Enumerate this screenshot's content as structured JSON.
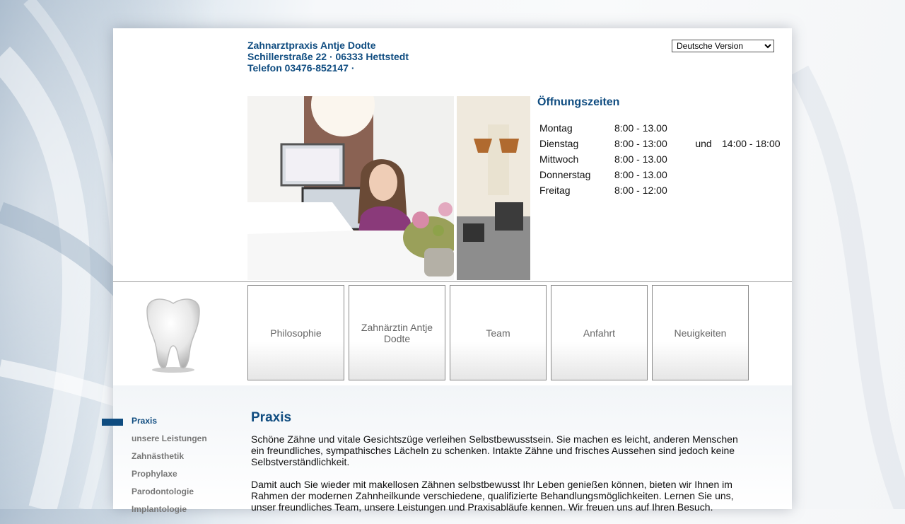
{
  "header": {
    "practice_name": "Zahnarztpraxis Antje Dodte",
    "address": "Schillerstraße 22 · 06333 Hettstedt",
    "phone": "Telefon 03476-852147 ·"
  },
  "language_select": {
    "selected": "Deutsche Version"
  },
  "opening_hours": {
    "title": "Öffnungszeiten",
    "rows": [
      {
        "day": "Montag",
        "time": "8:00 - 13.00",
        "joiner": "",
        "extra": ""
      },
      {
        "day": "Dienstag",
        "time": "8:00 - 13:00",
        "joiner": "und",
        "extra": "14:00 - 18:00"
      },
      {
        "day": "Mittwoch",
        "time": "8:00 - 13.00",
        "joiner": "",
        "extra": ""
      },
      {
        "day": "Donnerstag",
        "time": "8:00 - 13.00",
        "joiner": "",
        "extra": ""
      },
      {
        "day": "Freitag",
        "time": "8:00 - 12:00",
        "joiner": "",
        "extra": ""
      }
    ]
  },
  "nav": {
    "items": [
      {
        "label": "Philosophie"
      },
      {
        "label": "Zahnärztin Antje Dodte"
      },
      {
        "label": "Team"
      },
      {
        "label": "Anfahrt"
      },
      {
        "label": "Neuigkeiten"
      }
    ]
  },
  "sidebar": {
    "items": [
      {
        "label": "Praxis",
        "active": true
      },
      {
        "label": "unsere Leistungen"
      },
      {
        "label": "Zahnästhetik"
      },
      {
        "label": "Prophylaxe"
      },
      {
        "label": "Parodontologie"
      },
      {
        "label": "Implantologie"
      }
    ]
  },
  "main": {
    "title": "Praxis",
    "paragraphs": [
      "Schöne Zähne und vitale Gesichtszüge verleihen Selbstbewusstsein. Sie machen es leicht, anderen Menschen ein freundliches, sympathisches Lächeln zu schenken. Intakte Zähne und frisches Aussehen sind jedoch keine Selbstverständlichkeit.",
      "Damit auch Sie wieder mit makellosen Zähnen selbstbewusst Ihr Leben genießen können, bieten wir Ihnen im Rahmen der modernen Zahnheilkunde verschiedene, qualifizierte Behandlungsmöglichkeiten. Lernen Sie uns, unser freundliches Team, unsere Leistungen und Praxisabläufe kennen. Wir freuen uns auf Ihren Besuch."
    ]
  },
  "colors": {
    "brand": "#0f4c80",
    "nav_text": "#666666"
  }
}
